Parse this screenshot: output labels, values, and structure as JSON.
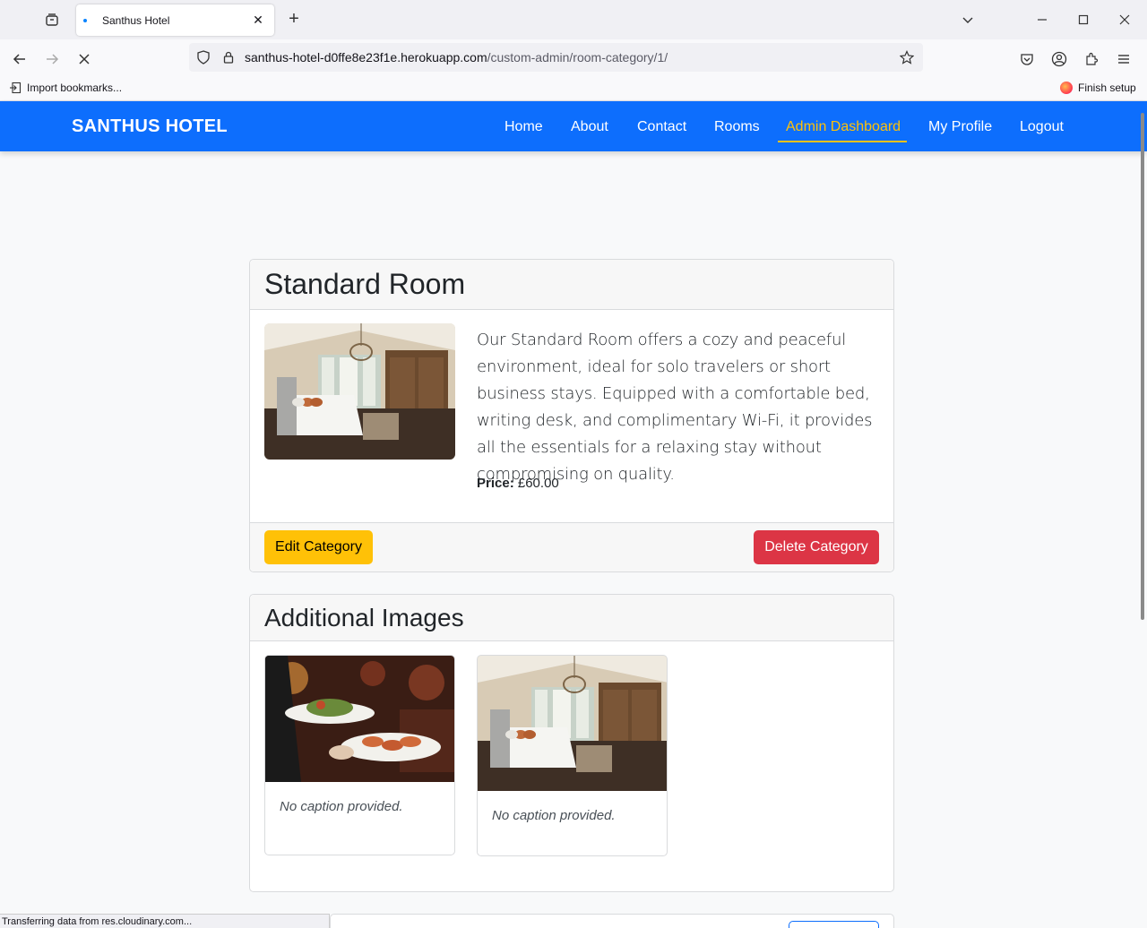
{
  "browser": {
    "tab_title": "Santhus Hotel",
    "url_domain": "santhus-hotel-d0ffe8e23f1e.herokuapp.com",
    "url_path": "/custom-admin/room-category/1/",
    "bookmark_import": "Import bookmarks...",
    "finish_setup": "Finish setup",
    "status_text": "Transferring data from res.cloudinary.com..."
  },
  "site": {
    "brand": "SANTHUS HOTEL",
    "nav": {
      "home": "Home",
      "about": "About",
      "contact": "Contact",
      "rooms": "Rooms",
      "admin": "Admin Dashboard",
      "profile": "My Profile",
      "logout": "Logout"
    }
  },
  "room": {
    "title": "Standard Room",
    "description": "Our Standard Room offers a cozy and peaceful environment, ideal for solo travelers or short business stays. Equipped with a comfortable bed, writing desk, and complimentary Wi-Fi, it provides all the essentials for a relaxing stay without compromising on quality.",
    "price_label": "Price:",
    "price_value": "£60.00",
    "edit_label": "Edit Category",
    "delete_label": "Delete Category"
  },
  "additional": {
    "title": "Additional Images",
    "images": [
      {
        "caption": "No caption provided."
      },
      {
        "caption": "No caption provided."
      }
    ]
  },
  "colors": {
    "primary": "#0d6efd",
    "warning": "#ffc107",
    "danger": "#dc3545"
  }
}
